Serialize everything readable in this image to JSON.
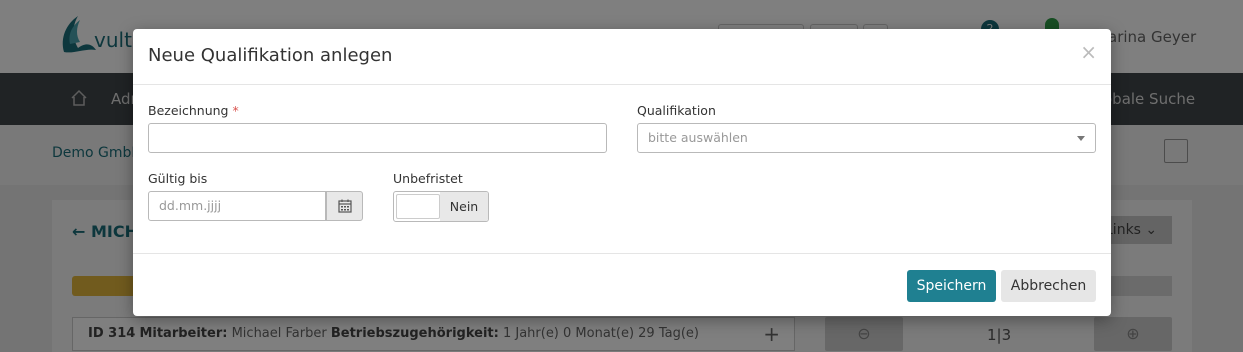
{
  "app": {
    "logo_text": "vultu",
    "user_name": "arina Geyer",
    "notification_count": "2",
    "nav": {
      "item1": "Adr",
      "global_search": "obale Suche"
    },
    "breadcrumb": "Demo GmbH",
    "back_title": "MICH",
    "links_label": "Links",
    "info": {
      "id_label": "ID 314",
      "employee_label": "Mitarbeiter:",
      "employee_name": "Michael Farber",
      "tenure_label": "Betriebszugehörigkeit:",
      "tenure_value": "1 Jahr(e) 0 Monat(e) 29 Tag(e)"
    },
    "pager": "1|3",
    "colors": {
      "accent": "#1f8091",
      "navbar": "#40474b",
      "warning_bar": "#e3b63c",
      "required": "#d9534f"
    }
  },
  "modal": {
    "title": "Neue Qualifikation anlegen",
    "close_icon": "close-icon",
    "fields": {
      "bezeichnung": {
        "label": "Bezeichnung",
        "required_marker": "*",
        "value": ""
      },
      "qualifikation": {
        "label": "Qualifikation",
        "placeholder": "bitte auswählen"
      },
      "gueltig_bis": {
        "label": "Gültig bis",
        "placeholder": "dd.mm.jjjj",
        "icon": "calendar-icon"
      },
      "unbefristet": {
        "label": "Unbefristet",
        "state_label": "Nein"
      }
    },
    "buttons": {
      "save": "Speichern",
      "cancel": "Abbrechen"
    }
  }
}
